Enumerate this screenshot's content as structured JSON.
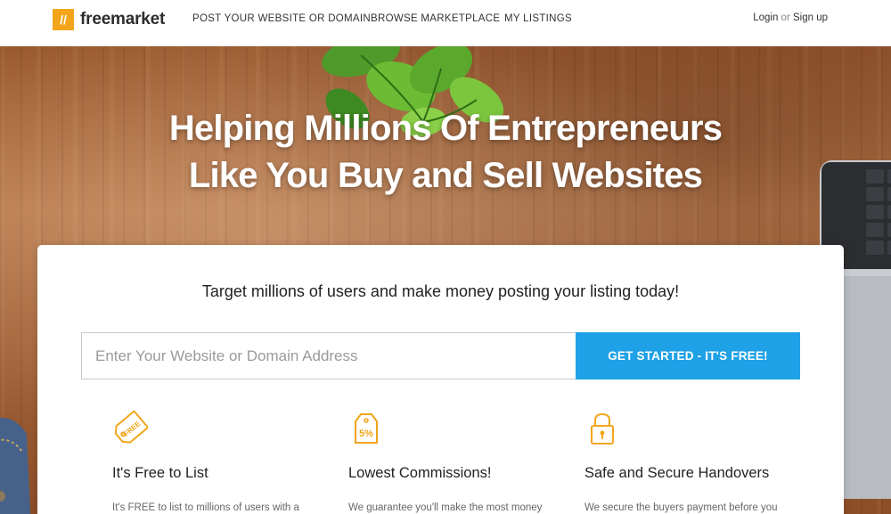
{
  "header": {
    "logo_mark": "//",
    "logo_text": "freemarket",
    "nav": [
      "POST YOUR WEBSITE OR DOMAIN",
      "BROWSE MARKETPLACE",
      "MY LISTINGS"
    ],
    "login": "Login",
    "or": "or",
    "signup": "Sign up"
  },
  "hero": {
    "title_line1": "Helping Millions Of Entrepreneurs",
    "title_line2": "Like You Buy and Sell Websites"
  },
  "card": {
    "heading": "Target millions of users and make money posting your listing today!",
    "search_placeholder": "Enter Your Website or Domain Address",
    "search_value": "",
    "cta_label": "GET STARTED - IT'S FREE!"
  },
  "features": [
    {
      "icon": "free-tag-icon",
      "icon_text": "FREE",
      "title": "It's Free to List",
      "text": "It's FREE to list to millions of users with a"
    },
    {
      "icon": "percent-tag-icon",
      "icon_text": "5%",
      "title": "Lowest Commissions!",
      "text": "We guarantee you'll make the most money"
    },
    {
      "icon": "padlock-icon",
      "icon_text": "",
      "title": "Safe and Secure Handovers",
      "text": "We secure the buyers payment before you"
    }
  ],
  "colors": {
    "accent_blue": "#1ea1e6",
    "brand_orange": "#f2a51a"
  }
}
